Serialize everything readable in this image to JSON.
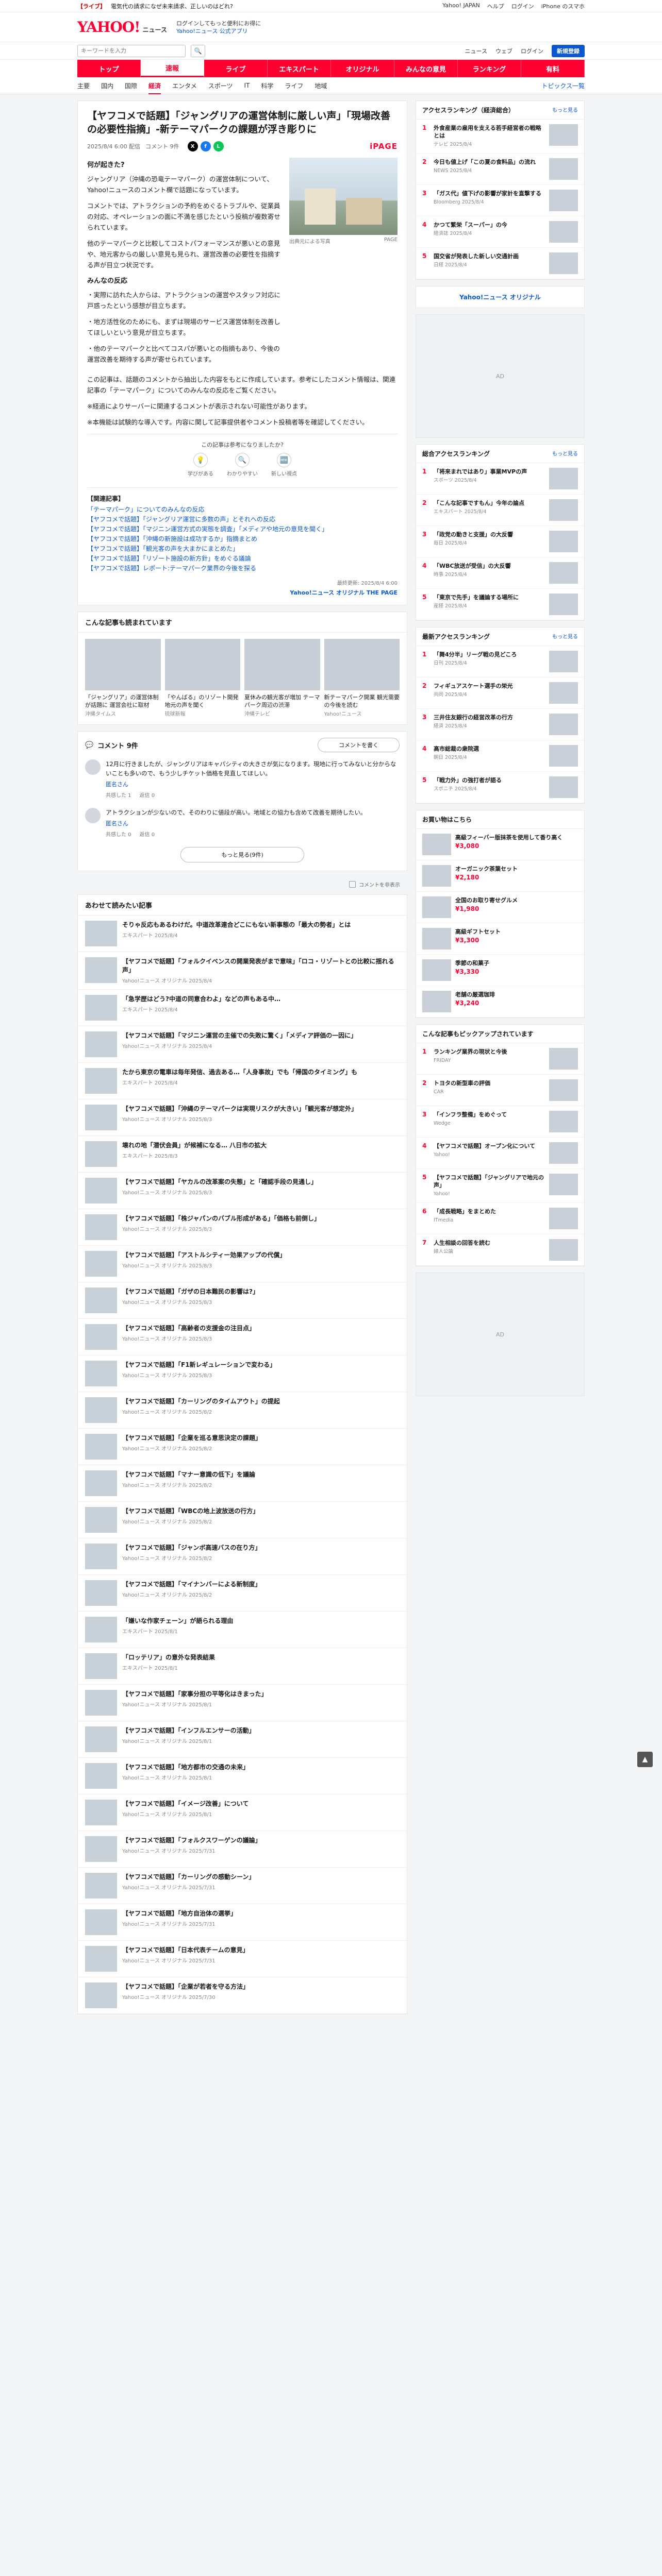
{
  "alert": {
    "tag": "【ライブ】",
    "text": "電気代の請求になぜ未来請求、正しいのはどれ?",
    "right_links": [
      "Yahoo! JAPAN",
      "ヘルプ",
      "ログイン",
      "iPhone のスマホ"
    ]
  },
  "masthead": {
    "logo": "YAHOO!",
    "logo_sub": "ニュース",
    "link1": "ログインしてもっと便利にお得に",
    "link2": "Yahoo!ニュース 公式アプリ"
  },
  "search": {
    "placeholder": "キーワードを入力",
    "button": "🔍",
    "right_links": [
      "ニュース",
      "ウェブ",
      "ログイン"
    ],
    "login": "新規登録"
  },
  "nav": {
    "primary": [
      "トップ",
      "速報",
      "ライブ",
      "エキスパート",
      "オリジナル",
      "みんなの意見",
      "ランキング",
      "有料"
    ],
    "primary_active": 1,
    "secondary": [
      "主要",
      "国内",
      "国際",
      "経済",
      "エンタメ",
      "スポーツ",
      "IT",
      "科学",
      "ライフ",
      "地域"
    ],
    "secondary_active": 3,
    "more": "トピックス一覧"
  },
  "article": {
    "headline": "【ヤフコメで話題】「ジャングリアの運営体制に厳しい声」「現場改善の必要性指摘」-新テーマパークの課題が浮き彫りに",
    "date": "2025/8/4 6:00 配信",
    "comments_count": "コメント 9件",
    "publisher": "iPAGE",
    "sections": [
      {
        "heading": "何が起きた?",
        "text": "ジャングリア（沖縄の恐竜テーマパーク）の運営体制について、Yahoo!ニュースのコメント欄で話題になっています。"
      },
      {
        "heading": "",
        "text": "コメントでは、アトラクションの予約をめぐるトラブルや、従業員の対応、オペレーションの面に不満を感じたという投稿が複数寄せられています。"
      },
      {
        "heading": "",
        "text": "他のテーマパークと比較してコストパフォーマンスが悪いとの意見や、地元客からの厳しい意見も見られ、運営改善の必要性を指摘する声が目立つ状況です。"
      },
      {
        "heading": "みんなの反応",
        "text": "・実際に訪れた人からは、アトラクションの運営やスタッフ対応に戸惑ったという感想が目立ちます。"
      },
      {
        "heading": "",
        "text": "・地方活性化のためにも、まずは現場のサービス運営体制を改善してほしいという意見が目立ちます。"
      },
      {
        "heading": "",
        "text": "・他のテーマパークと比べてコスパが悪いとの指摘もあり、今後の運営改善を期待する声が寄せられています。"
      }
    ],
    "figure_caption": "出典元による写真",
    "figure_source": "PAGE",
    "notes": [
      "この記事は、話題のコメントから抽出した内容をもとに作成しています。参考にしたコメント情報は、関連記事の「テーマパーク」についてのみんなの反応をご覧ください。",
      "※経過によりサーバーに関連するコメントが表示されない可能性があります。",
      "※本機能は試験的な導入です。内容に関して記事提供者やコメント投稿者等を確認してください。"
    ],
    "reactions": [
      {
        "icon": "💡",
        "label": "学びがある"
      },
      {
        "icon": "🔍",
        "label": "わかりやすい"
      },
      {
        "icon": "🆕",
        "label": "新しい視点"
      }
    ],
    "reaction_prompt": "この記事は参考になりましたか?",
    "related_title": "【関連記事】",
    "related_links": [
      "「テーマパーク」についてのみんなの反応",
      "【ヤフコメで話題】「ジャングリア運営に多数の声」とそれへの反応",
      "【ヤフコメで話題】「マジニン運営方式の実態を調査」「メディアや地元の意見を聞く」",
      "【ヤフコメで話題】「沖縄の新施設は成功するか」指摘まとめ",
      "【ヤフコメで話題】「観光客の声を大まかにまとめた」",
      "【ヤフコメで話題】「リゾート施設の新方針」をめぐる議論",
      "【ヤフコメで話題】レポート:テーマパーク業界の今後を探る"
    ],
    "footer_date": "最終更新: 2025/8/4 6:00",
    "footer_source": "Yahoo!ニュース オリジナル THE PAGE"
  },
  "recommend": {
    "title": "こんな記事も読まれています",
    "items": [
      {
        "title": "「ジャングリア」の運営体制が話題に 運営会社に取材",
        "src": "沖縄タイムス"
      },
      {
        "title": "「やんばる」のリゾート開発 地元の声を聞く",
        "src": "琉球新報"
      },
      {
        "title": "夏休みの観光客が増加 テーマパーク周辺の渋滞",
        "src": "沖縄テレビ"
      },
      {
        "title": "新テーマパーク開業 観光需要の今後を読む",
        "src": "Yahoo!ニュース"
      }
    ]
  },
  "comments": {
    "title": "コメント 9件",
    "post_button": "コメントを書く",
    "items": [
      {
        "text": "12月に行きましたが、ジャングリアはキャパシティの大きさが気になります。現地に行ってみないと分からないことも多いので、もう少しチケット価格を見直してほしい。",
        "user": "匿名さん",
        "likes": "共感した 1",
        "replies": "返信 0"
      },
      {
        "text": "アトラクションが少ないので、そのわりに値段が高い。地域との協力も含めて改善を期待したい。",
        "user": "匿名さん",
        "likes": "共感した 0",
        "replies": "返信 0"
      }
    ],
    "more_button": "もっと見る(9件)",
    "hide_label": "コメントを非表示"
  },
  "latest": {
    "title": "あわせて読みたい記事",
    "items": [
      {
        "title": "そりゃ反応もあるわけだ。中道改革連合どこにもない新事態の「最大の勢者」とは",
        "src": "エキスパート 2025/8/4"
      },
      {
        "title": "【ヤフコメで話題】「フォルクイベンスの開業発表がまで意味」「ロコ・リゾートとの比較に揺れる声」",
        "src": "Yahoo!ニュース オリジナル 2025/8/4"
      },
      {
        "title": "「急学歴はどう?中道の同意合わよ」などの声もある中…",
        "src": "エキスパート 2025/8/4"
      },
      {
        "title": "【ヤフコメで話題】「マジニン運営の主催での失敗に驚く」「メディア評価の一因に」",
        "src": "Yahoo!ニュース オリジナル 2025/8/4"
      },
      {
        "title": "たから東京の電車は毎年発信、過去ある…「人身事故」でも「帰国のタイミング」も",
        "src": "エキスパート 2025/8/4"
      },
      {
        "title": "【ヤフコメで話題】「沖縄のテーマパークは実現リスクが大きい」「観光客が想定外」",
        "src": "Yahoo!ニュース オリジナル 2025/8/3"
      },
      {
        "title": "壊れの地「潜伏会員」が候補になる… 八日市の拡大",
        "src": "エキスパート 2025/8/3"
      },
      {
        "title": "【ヤフコメで話題】「ヤカルの改革案の失態」と「確認手段の見通し」",
        "src": "Yahoo!ニュース オリジナル 2025/8/3"
      },
      {
        "title": "【ヤフコメで話題】「株ジャパンのバブル形成がある」「価格も前倒し」",
        "src": "Yahoo!ニュース オリジナル 2025/8/3"
      },
      {
        "title": "【ヤフコメで話題】「アストルシティー効果アップの代償」",
        "src": "Yahoo!ニュース オリジナル 2025/8/3"
      },
      {
        "title": "【ヤフコメで話題】「ガザの日本難民の影響は?」",
        "src": "Yahoo!ニュース オリジナル 2025/8/3"
      },
      {
        "title": "【ヤフコメで話題】「高齢者の支援金の注目点」",
        "src": "Yahoo!ニュース オリジナル 2025/8/3"
      },
      {
        "title": "【ヤフコメで話題】「F1新レギュレーションで変わる」",
        "src": "Yahoo!ニュース オリジナル 2025/8/3"
      },
      {
        "title": "【ヤフコメで話題】「カーリングのタイムアウト」の提起",
        "src": "Yahoo!ニュース オリジナル 2025/8/2"
      },
      {
        "title": "【ヤフコメで話題】「企業を巡る意思決定の課題」",
        "src": "Yahoo!ニュース オリジナル 2025/8/2"
      },
      {
        "title": "【ヤフコメで話題】「マナー意識の低下」を議論",
        "src": "Yahoo!ニュース オリジナル 2025/8/2"
      },
      {
        "title": "【ヤフコメで話題】「WBCの地上波放送の行方」",
        "src": "Yahoo!ニュース オリジナル 2025/8/2"
      },
      {
        "title": "【ヤフコメで話題】「ジャンボ高速バスの在り方」",
        "src": "Yahoo!ニュース オリジナル 2025/8/2"
      },
      {
        "title": "【ヤフコメで話題】「マイナンバーによる新制度」",
        "src": "Yahoo!ニュース オリジナル 2025/8/2"
      },
      {
        "title": "「嫌いな作家チェーン」が語られる理由",
        "src": "エキスパート 2025/8/1"
      },
      {
        "title": "「ロッテリア」の意外な発表結果",
        "src": "エキスパート 2025/8/1"
      },
      {
        "title": "【ヤフコメで話題】「家事分担の平等化はきまった」",
        "src": "Yahoo!ニュース オリジナル 2025/8/1"
      },
      {
        "title": "【ヤフコメで話題】「インフルエンサーの活動」",
        "src": "Yahoo!ニュース オリジナル 2025/8/1"
      },
      {
        "title": "【ヤフコメで話題】「地方都市の交通の未来」",
        "src": "Yahoo!ニュース オリジナル 2025/8/1"
      },
      {
        "title": "【ヤフコメで話題】「イメージ改善」について",
        "src": "Yahoo!ニュース オリジナル 2025/8/1"
      },
      {
        "title": "【ヤフコメで話題】「フォルクスワーゲンの議論」",
        "src": "Yahoo!ニュース オリジナル 2025/7/31"
      },
      {
        "title": "【ヤフコメで話題】「カーリングの感動シーン」",
        "src": "Yahoo!ニュース オリジナル 2025/7/31"
      },
      {
        "title": "【ヤフコメで話題】「地方自治体の選挙」",
        "src": "Yahoo!ニュース オリジナル 2025/7/31"
      },
      {
        "title": "【ヤフコメで話題】「日本代表チームの意見」",
        "src": "Yahoo!ニュース オリジナル 2025/7/31"
      },
      {
        "title": "【ヤフコメで話題】「企業が若者を守る方法」",
        "src": "Yahoo!ニュース オリジナル 2025/7/30"
      }
    ]
  },
  "sidebar": {
    "ranking1": {
      "title": "アクセスランキング（経済総合）",
      "more": "もっと見る",
      "items": [
        {
          "n": "1",
          "title": "外食産業の雇用を支える若手経営者の戦略とは",
          "src": "テレビ 2025/8/4"
        },
        {
          "n": "2",
          "title": "今日も値上げ「この夏の食料品」の流れ",
          "src": "NEWS 2025/8/4"
        },
        {
          "n": "3",
          "title": "「ガス代」値下げの影響が家計を直撃する",
          "src": "Bloomberg 2025/8/4"
        },
        {
          "n": "4",
          "title": "かつて繁栄「スーパー」の今",
          "src": "経済誌 2025/8/4"
        },
        {
          "n": "5",
          "title": "国交省が発表した新しい交通計画",
          "src": "日経 2025/8/4"
        }
      ]
    },
    "original_banner": "Yahoo!ニュース オリジナル",
    "ranking2": {
      "title": "総合アクセスランキング",
      "more": "もっと見る",
      "items": [
        {
          "n": "1",
          "title": "「将来まれではあり」事業MVPの声",
          "src": "スポーツ 2025/8/4"
        },
        {
          "n": "2",
          "title": "「こんな記事ですもん」今年の論点",
          "src": "エキスパート 2025/8/4"
        },
        {
          "n": "3",
          "title": "「政党の動きと支援」の大反響",
          "src": "毎日 2025/8/4"
        },
        {
          "n": "4",
          "title": "「WBC放送が受信」の大反響",
          "src": "時事 2025/8/4"
        },
        {
          "n": "5",
          "title": "「東京で先手」を議論する場所に",
          "src": "産経 2025/8/4"
        }
      ]
    },
    "ranking3": {
      "title": "最新アクセスランキング",
      "more": "もっと見る",
      "items": [
        {
          "n": "1",
          "title": "「舞4分半」リーグ戦の見どころ",
          "src": "日刊 2025/8/4"
        },
        {
          "n": "2",
          "title": "フィギュアスケート選手の栄光",
          "src": "共同 2025/8/4"
        },
        {
          "n": "3",
          "title": "三井住友銀行の経営改革の行方",
          "src": "経済 2025/8/4"
        },
        {
          "n": "4",
          "title": "高市総裁の衆院選",
          "src": "朝日 2025/8/4"
        },
        {
          "n": "5",
          "title": "「戦力外」の強打者が語る",
          "src": "スポニチ 2025/8/4"
        }
      ]
    },
    "shopping": {
      "title": "お買い物はこちら",
      "items": [
        {
          "title": "高級フィーバー版抹茶を使用して香り高く",
          "price": "¥3,080"
        },
        {
          "title": "オーガニック茶葉セット",
          "price": "¥2,180"
        },
        {
          "title": "全国のお取り寄せグルメ",
          "price": "¥1,980"
        },
        {
          "title": "高級ギフトセット",
          "price": "¥3,300"
        },
        {
          "title": "季節の和菓子",
          "price": "¥3,330"
        },
        {
          "title": "老舗の厳選珈琲",
          "price": "¥3,240"
        }
      ]
    },
    "ranking4": {
      "title": "こんな記事もピックアップされています",
      "items": [
        {
          "n": "1",
          "title": "ランキング業界の現状と今後",
          "src": "FRIDAY"
        },
        {
          "n": "2",
          "title": "トヨタの新型車の評価",
          "src": "CAR"
        },
        {
          "n": "3",
          "title": "「インフラ整備」をめぐって",
          "src": "Wedge"
        },
        {
          "n": "4",
          "title": "【ヤフコメで話題】オープン化について",
          "src": "Yahoo!"
        },
        {
          "n": "5",
          "title": "【ヤフコメで話題】「ジャングリアで地元の声」",
          "src": "Yahoo!"
        },
        {
          "n": "6",
          "title": "「成長戦略」をまとめた",
          "src": "ITmedia"
        },
        {
          "n": "7",
          "title": "人生相談の回答を読む",
          "src": "婦人公論"
        }
      ]
    }
  },
  "scroll_top": "▲"
}
